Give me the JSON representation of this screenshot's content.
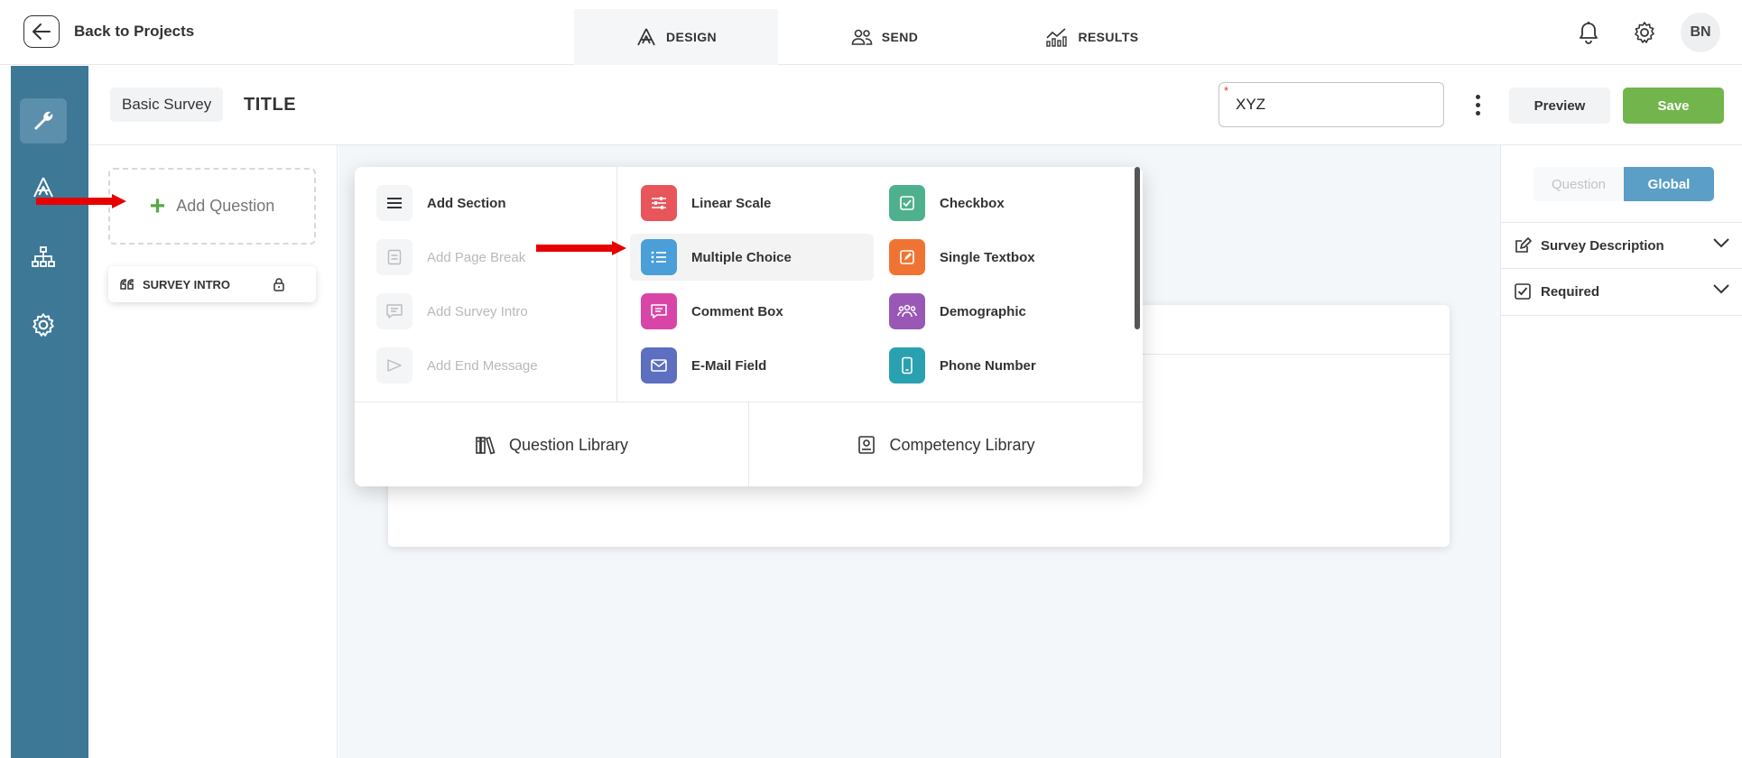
{
  "topbar": {
    "back_label": "Back to Projects",
    "tabs": [
      {
        "label": "DESIGN",
        "icon": "design-icon",
        "active": true
      },
      {
        "label": "SEND",
        "icon": "users-icon",
        "active": false
      },
      {
        "label": "RESULTS",
        "icon": "chart-icon",
        "active": false
      }
    ],
    "avatar": "BN"
  },
  "sidebar": {
    "items": [
      {
        "icon": "wrench-icon",
        "active": true
      },
      {
        "icon": "design-icon",
        "active": false
      },
      {
        "icon": "hierarchy-icon",
        "active": false
      },
      {
        "icon": "gear-icon",
        "active": false
      }
    ]
  },
  "subheader": {
    "survey_type": "Basic Survey",
    "title": "TITLE",
    "name_value": "XYZ",
    "required_mark": "*",
    "preview_label": "Preview",
    "save_label": "Save"
  },
  "left_panel": {
    "add_question": "Add Question",
    "intro_card": "SURVEY INTRO"
  },
  "menu": {
    "structure_items": [
      {
        "label": "Add Section",
        "icon": "menu-lines-icon",
        "enabled": true
      },
      {
        "label": "Add Page Break",
        "icon": "page-break-icon",
        "enabled": false
      },
      {
        "label": "Add Survey Intro",
        "icon": "speech-bubble-icon",
        "enabled": false
      },
      {
        "label": "Add End Message",
        "icon": "flag-icon",
        "enabled": false
      }
    ],
    "question_types": [
      {
        "label": "Linear Scale",
        "icon": "sliders-icon",
        "color": "#e8555a"
      },
      {
        "label": "Checkbox",
        "icon": "checkbox-icon",
        "color": "#4fb08e"
      },
      {
        "label": "Multiple Choice",
        "icon": "list-icon",
        "color": "#4a9fd8",
        "hover": true
      },
      {
        "label": "Single Textbox",
        "icon": "edit-icon",
        "color": "#ef7434"
      },
      {
        "label": "Comment Box",
        "icon": "comment-icon",
        "color": "#d945a7"
      },
      {
        "label": "Demographic",
        "icon": "group-icon",
        "color": "#9958b6"
      },
      {
        "label": "E-Mail Field",
        "icon": "mail-icon",
        "color": "#5d6fc0"
      },
      {
        "label": "Phone Number",
        "icon": "phone-icon",
        "color": "#2aa1b0"
      }
    ],
    "question_library": "Question Library",
    "competency_library": "Competency Library"
  },
  "right_panel": {
    "tab_question": "Question",
    "tab_global": "Global",
    "survey_description": "Survey Description",
    "required": "Required"
  },
  "colors": {
    "sidebar": "#3d7896",
    "save": "#72b54d",
    "global_tab": "#5b9ec6",
    "annotation_arrow": "#e60000"
  }
}
